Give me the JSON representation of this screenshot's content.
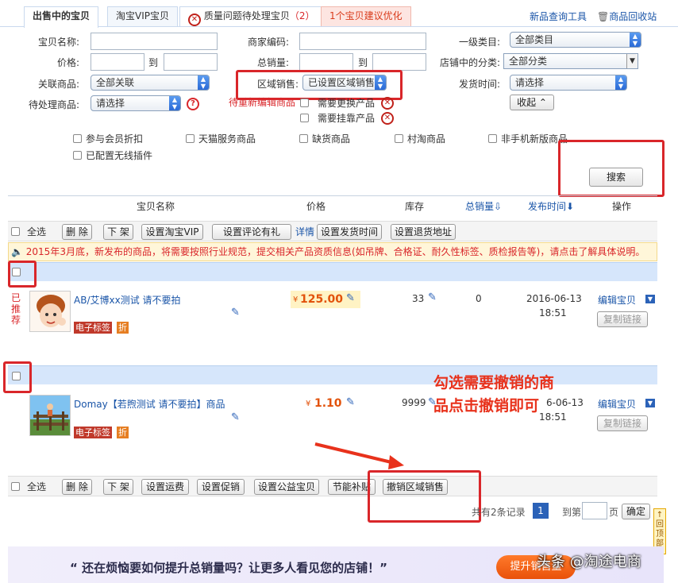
{
  "tabs": [
    {
      "label": "出售中的宝贝"
    },
    {
      "label": "淘宝VIP宝贝"
    },
    {
      "label": "质量问题待处理宝贝"
    },
    {
      "label": "1个宝贝建议优化"
    }
  ],
  "tab_quality_count": "（2）",
  "top_links": {
    "new_product_tool": "新品查询工具",
    "recycle": "商品回收站"
  },
  "form": {
    "item_name_label": "宝贝名称:",
    "merchant_code_label": "商家编码:",
    "category1_label": "一级类目:",
    "category1_value": "全部类目",
    "price_label": "价格:",
    "to1": "到",
    "total_sales_label": "总销量:",
    "to2": "到",
    "store_category_label": "店铺中的分类:",
    "store_category_value": "全部分类",
    "linked_label": "关联商品:",
    "linked_value": "全部关联",
    "region_label": "区域销售:",
    "region_value": "已设置区域销售",
    "ship_time_label": "发货时间:",
    "ship_time_value": "请选择",
    "pending_label": "待处理商品:",
    "pending_value": "请选择",
    "pending_edit_text": "待重新编辑商品",
    "need_replace": "需要更换产品",
    "need_mount": "需要挂靠产品",
    "collapse_btn": "收起 ⌃",
    "member_discount": "参与会员折扣",
    "tmall_service": "天猫服务商品",
    "out_of_stock": "缺货商品",
    "village": "村淘商品",
    "non_mobile": "非手机新版商品",
    "wireless_plugin": "已配置无线插件",
    "search_btn": "搜索"
  },
  "table_header": {
    "name": "宝贝名称",
    "price": "价格",
    "stock": "库存",
    "sales": "总销量⇩",
    "publish_time": "发布时间⬇",
    "ops": "操作"
  },
  "toolbar_top": {
    "select_all": "全选",
    "delete": "删 除",
    "off_shelf": "下 架",
    "set_vip": "设置淘宝VIP",
    "set_review": "设置评论有礼",
    "details": "详情",
    "set_ship_time": "设置发货时间",
    "set_return_addr": "设置退货地址"
  },
  "notice": "2015年3月底，新发布的商品，将需要按照行业规范，提交相关产品资质信息(如吊牌、合格证、耐久性标签、质检报告等)，请点击了解具体说明。",
  "products": [
    {
      "recommended": "已推荐",
      "title": "AB/艾博xx测试 请不要拍",
      "e_tag": "电子标签",
      "discount_tag": "折",
      "price_symbol": "¥",
      "price": "125.00",
      "stock": "33",
      "sales": "0",
      "date": "2016-06-13",
      "time": "18:51",
      "edit": "编辑宝贝",
      "copy": "复制链接"
    },
    {
      "recommended": "",
      "title": "Domay【若煦测试 请不要拍】商品",
      "e_tag": "电子标签",
      "discount_tag": "折",
      "price_symbol": "¥",
      "price": "1.10",
      "stock": "9999",
      "sales": "",
      "date": "6-06-13",
      "time": "18:51",
      "edit": "编辑宝贝",
      "copy": "复制链接"
    }
  ],
  "annotation": "勾选需要撤销的商品点击撤销即可",
  "toolbar_bottom": {
    "select_all": "全选",
    "delete": "删 除",
    "off_shelf": "下 架",
    "set_freight": "设置运费",
    "set_promo": "设置促销",
    "set_charity": "设置公益宝贝",
    "energy_subsidy": "节能补贴",
    "revoke_region": "撤销区域销售"
  },
  "pager": {
    "total": "共有2条记录",
    "page": "1",
    "goto": "到第",
    "page_unit": "页",
    "confirm": "确定"
  },
  "banner": {
    "text": "“ 还在烦恼要如何提升总销量吗？让更多人看见您的店铺！”",
    "button": "提升销售量"
  },
  "back_to_top": "回顶部",
  "watermark": "头条 @淘途电商"
}
